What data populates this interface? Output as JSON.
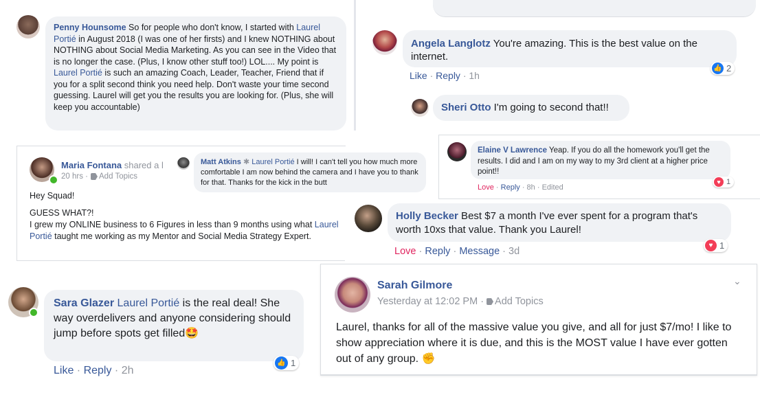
{
  "penny": {
    "name": "Penny Hounsome",
    "t1": " So for people who don't know, I started with ",
    "link1": "Laurel Portié",
    "t2": " in August 2018 (I was one of her firsts) and I knew NOTHING about NOTHING about Social Media Marketing. As you can see in the Video that is no longer the case. (Plus, I know other stuff too!) LOL.... My point is ",
    "link2": "Laurel Portié",
    "t3": " is such an amazing Coach, Leader, Teacher, Friend that if you for a split second think you need help. Don't waste your time second guessing. Laurel will get you the results you are looking for. (Plus, she will keep you accountable)"
  },
  "angela": {
    "name": "Angela Langlotz",
    "text": " You're amazing. This is the best value on the internet.",
    "like": "Like",
    "reply": "Reply",
    "time": "1h",
    "reaction_count": "2"
  },
  "sheri": {
    "name": "Sheri Otto",
    "text": " I'm going to second that!!"
  },
  "maria": {
    "name": "Maria Fontana",
    "shared": " shared a l",
    "time": "20 hrs",
    "add_topics": "Add Topics",
    "line1": "Hey Squad!",
    "line2": "GUESS WHAT?!",
    "line3": "I grew my ONLINE business to 6 Figures in less than 9 months using what",
    "link": "Laurel Portié",
    "line4": " taught me working as my Mentor and Social Media Strategy Expert."
  },
  "matt": {
    "name": "Matt Atkins",
    "tag": "Laurel Portié",
    "text": " I will! I can't tell you how much more comfortable I am now behind the camera and I have you to thank for that. Thanks for the kick in the butt"
  },
  "elaine": {
    "name": "Elaine V Lawrence",
    "text": " Yeap. If you do all the homework you'll get the results. I did and I am on my way to my 3rd client at a higher price point!!",
    "love": "Love",
    "reply": "Reply",
    "time": "8h",
    "edited": "Edited",
    "reaction_count": "1"
  },
  "holly": {
    "name": "Holly Becker",
    "text": " Best $7 a month I've ever spent for a program that's worth 10xs that value. Thank you Laurel!",
    "love": "Love",
    "reply": "Reply",
    "message": "Message",
    "time": "3d",
    "reaction_count": "1"
  },
  "sara": {
    "name": "Sara Glazer",
    "link": "Laurel Portié",
    "text": " is the real deal! She way overdelivers and anyone considering should jump before spots get filled",
    "emoji": "🤩",
    "like": "Like",
    "reply": "Reply",
    "time": "2h",
    "reaction_count": "1"
  },
  "sarah": {
    "name": "Sarah Gilmore",
    "time": "Yesterday at 12:02 PM",
    "add_topics": "Add Topics",
    "text": "Laurel, thanks for all of the massive value you give, and all for just $7/mo! I like to show appreciation where it is due, and this is the MOST value I have ever gotten out of any group. ",
    "emoji": "✊"
  },
  "colors": {
    "link": "#385898",
    "bubble": "#f0f2f5",
    "love": "#e0245e",
    "like_blue": "#1877f2"
  }
}
